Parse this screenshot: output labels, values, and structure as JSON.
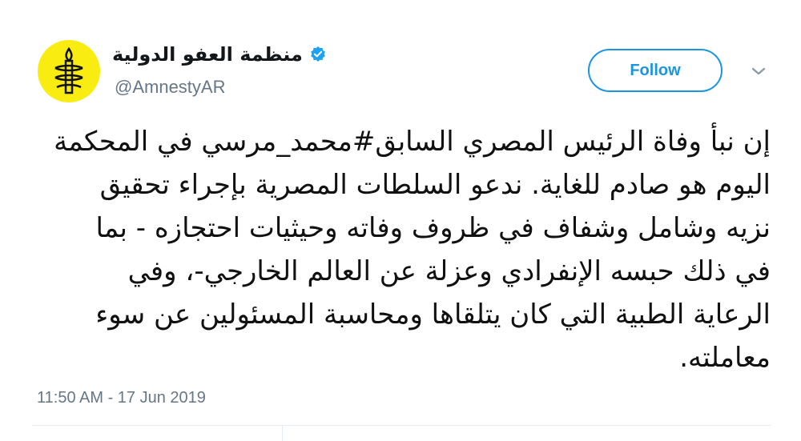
{
  "account": {
    "display_name": "منظمة العفو الدولية",
    "handle": "@AmnestyAR",
    "verified": true,
    "avatar_icon": "amnesty-candle-icon",
    "avatar_color": "#f9ec10"
  },
  "follow_label": "Follow",
  "tweet": {
    "lines": [
      "إن نبأ وفاة الرئيس المصري السابق#محمد_مرسي في المحكمة",
      "اليوم هو صادم للغاية. ندعو السلطات المصرية بإجراء تحقيق",
      "نزيه وشامل وشفاف في ظروف وفاته وحيثيات احتجازه - بما",
      "في ذلك حبسه الإنفرادي وعزلة عن العالم الخارجي-، وفي",
      "الرعاية الطبية التي كان يتلقاها ومحاسبة المسئولين عن سوء",
      "معاملته."
    ]
  },
  "timestamp": "11:50 AM - 17 Jun 2019",
  "colors": {
    "accent": "#1b95e0",
    "muted": "#657786"
  }
}
